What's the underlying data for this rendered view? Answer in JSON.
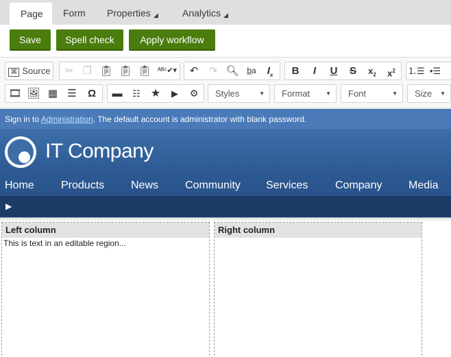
{
  "tabs": [
    {
      "label": "Page"
    },
    {
      "label": "Form"
    },
    {
      "label": "Properties"
    },
    {
      "label": "Analytics"
    }
  ],
  "actions": {
    "save": "Save",
    "spell_check": "Spell check",
    "apply_workflow": "Apply workflow"
  },
  "toolbar": {
    "source_label": "Source",
    "styles": "Styles",
    "format": "Format",
    "font": "Font",
    "size": "Size",
    "buttons_row1": [
      "cut-icon",
      "copy-icon",
      "paste-icon",
      "paste-text-icon",
      "paste-word-icon",
      "spell-check-icon",
      "undo-icon",
      "redo-icon",
      "find-icon",
      "replace-icon",
      "remove-format-icon",
      "bold-icon",
      "italic-icon",
      "underline-icon",
      "strikethrough-icon",
      "subscript-icon",
      "superscript-icon",
      "numbered-list-icon",
      "bulleted-list-icon"
    ],
    "buttons_row2": [
      "media-icon",
      "image-icon",
      "table-icon",
      "horizontal-line-icon",
      "special-char-icon",
      "folder-icon",
      "checklist-icon",
      "star-icon",
      "youtube-icon",
      "widget-icon"
    ]
  },
  "infobar": {
    "prefix": "Sign in to ",
    "link": "Administration",
    "suffix": ". The default account is administrator with blank password."
  },
  "site": {
    "company": "IT Company",
    "nav": [
      "Home",
      "Products",
      "News",
      "Community",
      "Services",
      "Company",
      "Media"
    ]
  },
  "columns": {
    "left_title": "Left column",
    "left_text": "This is text in an editable region...",
    "right_title": "Right column"
  },
  "colors": {
    "action_green": "#4a7d0d",
    "info_blue": "#4a7ab8",
    "header_blue": "#2e5b94",
    "breadcrumb_navy": "#1c3b66"
  }
}
